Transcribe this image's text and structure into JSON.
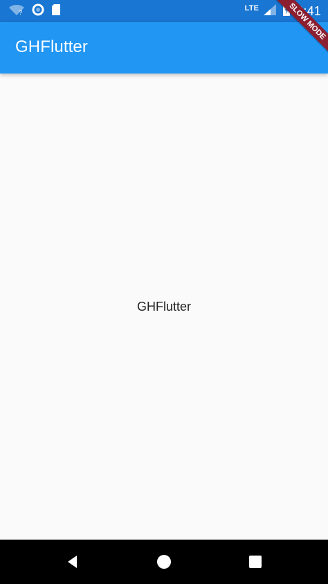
{
  "status_bar": {
    "network": "LTE",
    "time": "6:41",
    "icons": [
      "wifi-question-icon",
      "circle-status-icon",
      "sd-card-icon",
      "signal-icon",
      "battery-charging-icon"
    ]
  },
  "debug_banner": {
    "label": "SLOW MODE"
  },
  "app_bar": {
    "title": "GHFlutter"
  },
  "body": {
    "center_text": "GHFlutter"
  },
  "nav_bar": {
    "buttons": [
      "back",
      "home",
      "recents"
    ]
  },
  "colors": {
    "status_bar": "#1976d2",
    "app_bar": "#2196f3",
    "background": "#fafafa",
    "nav_bar": "#000000",
    "debug_banner": "#8b1e31"
  }
}
